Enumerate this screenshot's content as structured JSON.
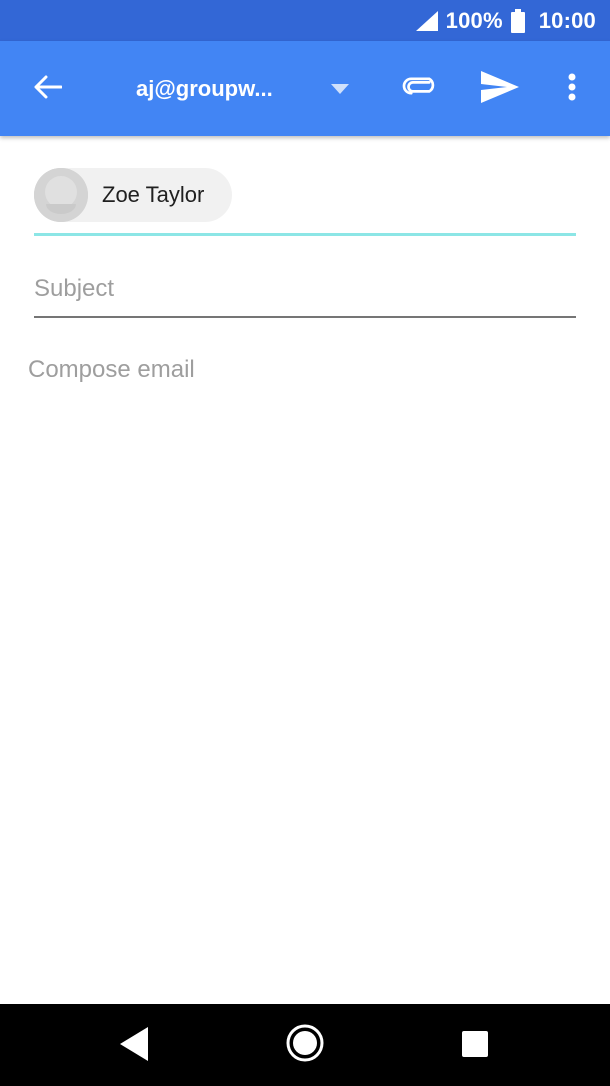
{
  "status_bar": {
    "battery_percent": "100%",
    "time": "10:00",
    "icons": [
      "signal-icon",
      "battery-icon"
    ]
  },
  "app_bar": {
    "account": "aj@groupw...",
    "icons": [
      "back-arrow-icon",
      "dropdown-arrow-icon",
      "paperclip-icon",
      "send-icon",
      "more-vert-icon"
    ],
    "colors": {
      "status_bar": "#3367d6",
      "toolbar": "#4285f4"
    }
  },
  "compose": {
    "to_chip": {
      "name": "Zoe Taylor",
      "icon": "contact-avatar-icon"
    },
    "to_underline_color": "#8ce6e6",
    "subject_placeholder": "Subject",
    "body_placeholder": "Compose email"
  },
  "nav_bar": {
    "icons": [
      "nav-back-icon",
      "nav-home-icon",
      "nav-recents-icon"
    ]
  }
}
